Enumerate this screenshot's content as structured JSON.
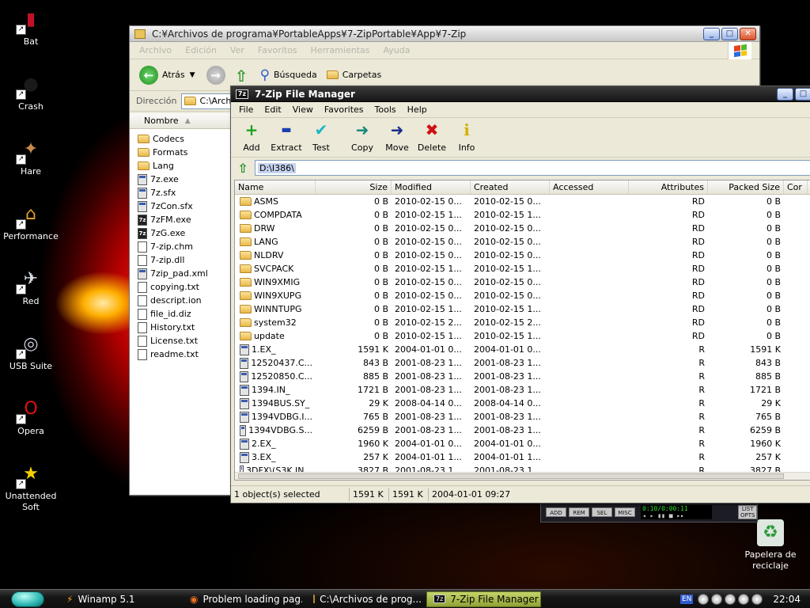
{
  "desktop": {
    "icons": [
      {
        "label": "Bat",
        "icon": "bat-icon",
        "glyph": "▮",
        "color": "#c0102a"
      },
      {
        "label": "Crash",
        "icon": "bomb-icon",
        "glyph": "●",
        "color": "#1a1a1a"
      },
      {
        "label": "Hare",
        "icon": "hare-icon",
        "glyph": "✦",
        "color": "#c88a4a"
      },
      {
        "label": "Performance",
        "icon": "house-icon",
        "glyph": "⌂",
        "color": "#e8a030"
      },
      {
        "label": "Red",
        "icon": "rocket-icon",
        "glyph": "✈",
        "color": "#d8dce8"
      },
      {
        "label": "USB Suite",
        "icon": "usb-globe-icon",
        "glyph": "◎",
        "color": "#c8ccd8"
      },
      {
        "label": "Opera",
        "icon": "opera-icon",
        "glyph": "O",
        "color": "#e01010"
      },
      {
        "label": "Unattended Soft",
        "icon": "star-icon",
        "glyph": "★",
        "color": "#f5d000"
      }
    ],
    "recycle_bin": {
      "label": "Papelera de reciclaje",
      "icon": "recycle-bin-icon"
    }
  },
  "explorer": {
    "title": "C:¥Archivos de programa¥PortableApps¥7-ZipPortable¥App¥7-Zip",
    "menu": [
      "Archivo",
      "Edición",
      "Ver",
      "Favoritos",
      "Herramientas",
      "Ayuda"
    ],
    "toolbar": {
      "back": "Atrás",
      "search": "Búsqueda",
      "folders": "Carpetas"
    },
    "address_label": "Dirección",
    "address_value": "C:\\Archi",
    "column_name": "Nombre",
    "files": [
      {
        "name": "Codecs",
        "type": "folder"
      },
      {
        "name": "Formats",
        "type": "folder"
      },
      {
        "name": "Lang",
        "type": "folder"
      },
      {
        "name": "7z.exe",
        "type": "exe"
      },
      {
        "name": "7z.sfx",
        "type": "exe"
      },
      {
        "name": "7zCon.sfx",
        "type": "exe"
      },
      {
        "name": "7zFM.exe",
        "type": "seven"
      },
      {
        "name": "7zG.exe",
        "type": "seven"
      },
      {
        "name": "7-zip.chm",
        "type": "file"
      },
      {
        "name": "7-zip.dll",
        "type": "file"
      },
      {
        "name": "7zip_pad.xml",
        "type": "exe"
      },
      {
        "name": "copying.txt",
        "type": "file"
      },
      {
        "name": "descript.ion",
        "type": "file"
      },
      {
        "name": "file_id.diz",
        "type": "file"
      },
      {
        "name": "History.txt",
        "type": "file"
      },
      {
        "name": "License.txt",
        "type": "file"
      },
      {
        "name": "readme.txt",
        "type": "file"
      }
    ]
  },
  "sevenzip": {
    "title": "7-Zip File Manager",
    "title_icon": "7z",
    "menu": [
      "File",
      "Edit",
      "View",
      "Favorites",
      "Tools",
      "Help"
    ],
    "tools": [
      {
        "label": "Add",
        "icon": "add-icon",
        "glyph": "+",
        "color": "#1fa31f"
      },
      {
        "label": "Extract",
        "icon": "extract-icon",
        "glyph": "▬",
        "color": "#1b3fb0"
      },
      {
        "label": "Test",
        "icon": "test-icon",
        "glyph": "✔",
        "color": "#1ab8c8"
      },
      {
        "label": "Copy",
        "icon": "copy-icon",
        "glyph": "➜",
        "color": "#1a8a7a"
      },
      {
        "label": "Move",
        "icon": "move-icon",
        "glyph": "➜",
        "color": "#1b2f8a"
      },
      {
        "label": "Delete",
        "icon": "delete-icon",
        "glyph": "✖",
        "color": "#d01010"
      },
      {
        "label": "Info",
        "icon": "info-icon",
        "glyph": "i",
        "color": "#d4b000"
      }
    ],
    "path": "D:\\I386\\",
    "columns": [
      "Name",
      "Size",
      "Modified",
      "Created",
      "Accessed",
      "Attributes",
      "Packed Size",
      "Cor"
    ],
    "rows": [
      {
        "name": "ASMS",
        "type": "folder",
        "size": "0 B",
        "modified": "2010-02-15 0...",
        "created": "2010-02-15 0...",
        "accessed": "",
        "attributes": "RD",
        "packed": "0 B"
      },
      {
        "name": "COMPDATA",
        "type": "folder",
        "size": "0 B",
        "modified": "2010-02-15 1...",
        "created": "2010-02-15 1...",
        "accessed": "",
        "attributes": "RD",
        "packed": "0 B"
      },
      {
        "name": "DRW",
        "type": "folder",
        "size": "0 B",
        "modified": "2010-02-15 0...",
        "created": "2010-02-15 0...",
        "accessed": "",
        "attributes": "RD",
        "packed": "0 B"
      },
      {
        "name": "LANG",
        "type": "folder",
        "size": "0 B",
        "modified": "2010-02-15 0...",
        "created": "2010-02-15 0...",
        "accessed": "",
        "attributes": "RD",
        "packed": "0 B"
      },
      {
        "name": "NLDRV",
        "type": "folder",
        "size": "0 B",
        "modified": "2010-02-15 0...",
        "created": "2010-02-15 0...",
        "accessed": "",
        "attributes": "RD",
        "packed": "0 B"
      },
      {
        "name": "SVCPACK",
        "type": "folder",
        "size": "0 B",
        "modified": "2010-02-15 1...",
        "created": "2010-02-15 1...",
        "accessed": "",
        "attributes": "RD",
        "packed": "0 B"
      },
      {
        "name": "WIN9XMIG",
        "type": "folder",
        "size": "0 B",
        "modified": "2010-02-15 0...",
        "created": "2010-02-15 0...",
        "accessed": "",
        "attributes": "RD",
        "packed": "0 B"
      },
      {
        "name": "WIN9XUPG",
        "type": "folder",
        "size": "0 B",
        "modified": "2010-02-15 0...",
        "created": "2010-02-15 0...",
        "accessed": "",
        "attributes": "RD",
        "packed": "0 B"
      },
      {
        "name": "WINNTUPG",
        "type": "folder",
        "size": "0 B",
        "modified": "2010-02-15 1...",
        "created": "2010-02-15 1...",
        "accessed": "",
        "attributes": "RD",
        "packed": "0 B"
      },
      {
        "name": "system32",
        "type": "folder",
        "size": "0 B",
        "modified": "2010-02-15 2...",
        "created": "2010-02-15 2...",
        "accessed": "",
        "attributes": "RD",
        "packed": "0 B"
      },
      {
        "name": "update",
        "type": "folder",
        "size": "0 B",
        "modified": "2010-02-15 1...",
        "created": "2010-02-15 1...",
        "accessed": "",
        "attributes": "RD",
        "packed": "0 B"
      },
      {
        "name": "1.EX_",
        "type": "file",
        "size": "1591 K",
        "modified": "2004-01-01 0...",
        "created": "2004-01-01 0...",
        "accessed": "",
        "attributes": "R",
        "packed": "1591 K"
      },
      {
        "name": "12520437.C...",
        "type": "file",
        "size": "843 B",
        "modified": "2001-08-23 1...",
        "created": "2001-08-23 1...",
        "accessed": "",
        "attributes": "R",
        "packed": "843 B"
      },
      {
        "name": "12520850.C...",
        "type": "file",
        "size": "885 B",
        "modified": "2001-08-23 1...",
        "created": "2001-08-23 1...",
        "accessed": "",
        "attributes": "R",
        "packed": "885 B"
      },
      {
        "name": "1394.IN_",
        "type": "file",
        "size": "1721 B",
        "modified": "2001-08-23 1...",
        "created": "2001-08-23 1...",
        "accessed": "",
        "attributes": "R",
        "packed": "1721 B"
      },
      {
        "name": "1394BUS.SY_",
        "type": "file",
        "size": "29 K",
        "modified": "2008-04-14 0...",
        "created": "2008-04-14 0...",
        "accessed": "",
        "attributes": "R",
        "packed": "29 K"
      },
      {
        "name": "1394VDBG.I...",
        "type": "file",
        "size": "765 B",
        "modified": "2001-08-23 1...",
        "created": "2001-08-23 1...",
        "accessed": "",
        "attributes": "R",
        "packed": "765 B"
      },
      {
        "name": "1394VDBG.S...",
        "type": "file",
        "size": "6259 B",
        "modified": "2001-08-23 1...",
        "created": "2001-08-23 1...",
        "accessed": "",
        "attributes": "R",
        "packed": "6259 B"
      },
      {
        "name": "2.EX_",
        "type": "file",
        "size": "1960 K",
        "modified": "2004-01-01 0...",
        "created": "2004-01-01 0...",
        "accessed": "",
        "attributes": "R",
        "packed": "1960 K"
      },
      {
        "name": "3.EX_",
        "type": "file",
        "size": "257 K",
        "modified": "2004-01-01 1...",
        "created": "2004-01-01 1...",
        "accessed": "",
        "attributes": "R",
        "packed": "257 K"
      },
      {
        "name": "3DFX\\(S3K.IN...",
        "type": "file",
        "size": "3827 B",
        "modified": "2001-08-23 1...",
        "created": "2001-08-23 1...",
        "accessed": "",
        "attributes": "R",
        "packed": "3827 B"
      }
    ],
    "status": {
      "selected": "1 object(s) selected",
      "size": "1591 K",
      "packed": "1591 K",
      "date": "2004-01-01 09:27"
    }
  },
  "winamp_mini": {
    "buttons": [
      "ADD",
      "REM",
      "SEL",
      "MISC"
    ],
    "display": "0:10/0:00:11",
    "list_btn": "LIST OPTS"
  },
  "taskbar": {
    "tasks": [
      {
        "label": "Winamp 5.1",
        "icon": "winamp-icon",
        "active": false
      },
      {
        "label": "Problem loading pag...",
        "icon": "firefox-icon",
        "active": false
      },
      {
        "label": "C:\\Archivos de prog...",
        "icon": "folder-icon",
        "active": false
      },
      {
        "label": "7-Zip File Manager",
        "icon": "7zip-icon",
        "active": true
      }
    ],
    "lang": "EN",
    "clock": "22:04"
  },
  "colors": {
    "accent": "#8fa234",
    "desktop_glow": "#ff2020"
  }
}
